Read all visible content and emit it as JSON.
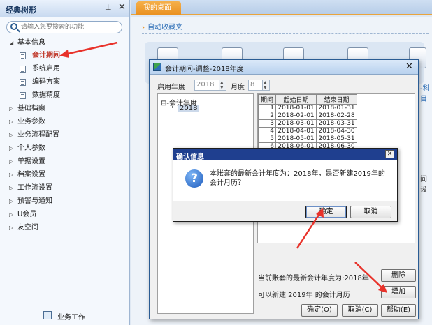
{
  "sidebar": {
    "title": "经典树形",
    "pin": "⊥",
    "close": "✕",
    "search_placeholder": "请输入您要搜索的功能",
    "expanded_group": "基本信息",
    "expanded_items": [
      "会计期间",
      "系统启用",
      "编码方案",
      "数据精度"
    ],
    "active_item": "会计期间",
    "collapsed_groups": [
      "基础档案",
      "业务参数",
      "业务流程配置",
      "个人参数",
      "单据设置",
      "档案设置",
      "工作流设置",
      "预警与通知",
      "U会员",
      "友空间"
    ],
    "footer_label": "业务工作"
  },
  "tabs": {
    "active": "我的桌面"
  },
  "main": {
    "fav_label": "自动收藏夹",
    "right_text_1": "-科目",
    "right_text_2": "间 设"
  },
  "dialog": {
    "title": "会计期间-调整-2018年度",
    "start_year_label": "启用年度",
    "start_year_value": "2018",
    "month_label": "月度",
    "month_value": "8",
    "tree_root": "会计年度",
    "tree_child": "2018",
    "grid_headers": [
      "期间",
      "起始日期",
      "结束日期"
    ],
    "grid_rows": [
      [
        "1",
        "2018-01-01",
        "2018-01-31"
      ],
      [
        "2",
        "2018-02-01",
        "2018-02-28"
      ],
      [
        "3",
        "2018-03-01",
        "2018-03-31"
      ],
      [
        "4",
        "2018-04-01",
        "2018-04-30"
      ],
      [
        "5",
        "2018-05-01",
        "2018-05-31"
      ],
      [
        "6",
        "2018-06-01",
        "2018-06-30"
      ]
    ],
    "latest_year_text": "当前账套的最新会计年度为:2018年",
    "can_create_text": "可以新建 2019年 的会计月历",
    "delete_label": "删除",
    "add_label": "增加",
    "ok_label": "确定(O)",
    "cancel_label": "取消(C)",
    "help_label": "帮助(E)"
  },
  "message_box": {
    "title": "确认信息",
    "message": "本账套的最新会计年度为：2018年，是否新建2019年的会计月历？",
    "ok_label": "确定",
    "cancel_label": "取消"
  },
  "colors": {
    "arrow": "#e8322a",
    "accent_tab": "#e98f1f",
    "title_bar": "#1f3f8f"
  }
}
